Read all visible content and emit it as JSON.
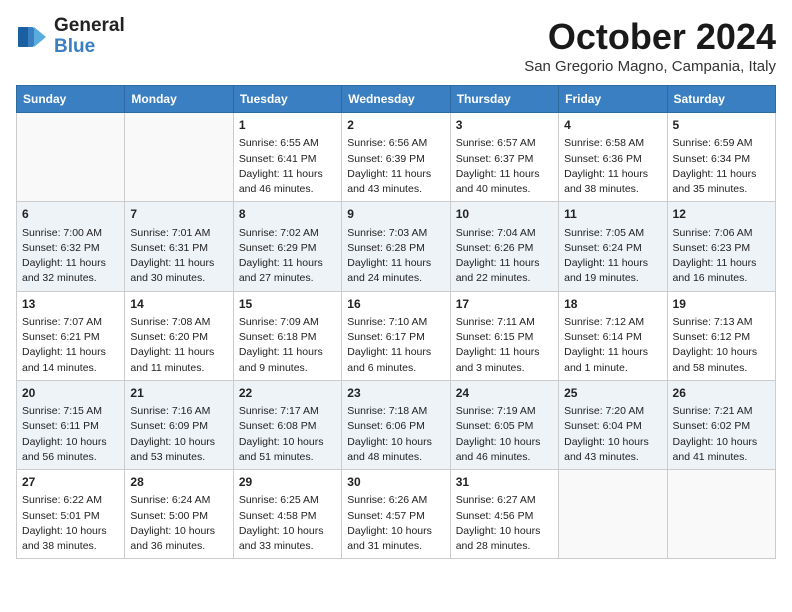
{
  "header": {
    "logo_line1": "General",
    "logo_line2": "Blue",
    "month": "October 2024",
    "location": "San Gregorio Magno, Campania, Italy"
  },
  "weekdays": [
    "Sunday",
    "Monday",
    "Tuesday",
    "Wednesday",
    "Thursday",
    "Friday",
    "Saturday"
  ],
  "weeks": [
    [
      {
        "day": null
      },
      {
        "day": null
      },
      {
        "day": "1",
        "sunrise": "Sunrise: 6:55 AM",
        "sunset": "Sunset: 6:41 PM",
        "daylight": "Daylight: 11 hours and 46 minutes."
      },
      {
        "day": "2",
        "sunrise": "Sunrise: 6:56 AM",
        "sunset": "Sunset: 6:39 PM",
        "daylight": "Daylight: 11 hours and 43 minutes."
      },
      {
        "day": "3",
        "sunrise": "Sunrise: 6:57 AM",
        "sunset": "Sunset: 6:37 PM",
        "daylight": "Daylight: 11 hours and 40 minutes."
      },
      {
        "day": "4",
        "sunrise": "Sunrise: 6:58 AM",
        "sunset": "Sunset: 6:36 PM",
        "daylight": "Daylight: 11 hours and 38 minutes."
      },
      {
        "day": "5",
        "sunrise": "Sunrise: 6:59 AM",
        "sunset": "Sunset: 6:34 PM",
        "daylight": "Daylight: 11 hours and 35 minutes."
      }
    ],
    [
      {
        "day": "6",
        "sunrise": "Sunrise: 7:00 AM",
        "sunset": "Sunset: 6:32 PM",
        "daylight": "Daylight: 11 hours and 32 minutes."
      },
      {
        "day": "7",
        "sunrise": "Sunrise: 7:01 AM",
        "sunset": "Sunset: 6:31 PM",
        "daylight": "Daylight: 11 hours and 30 minutes."
      },
      {
        "day": "8",
        "sunrise": "Sunrise: 7:02 AM",
        "sunset": "Sunset: 6:29 PM",
        "daylight": "Daylight: 11 hours and 27 minutes."
      },
      {
        "day": "9",
        "sunrise": "Sunrise: 7:03 AM",
        "sunset": "Sunset: 6:28 PM",
        "daylight": "Daylight: 11 hours and 24 minutes."
      },
      {
        "day": "10",
        "sunrise": "Sunrise: 7:04 AM",
        "sunset": "Sunset: 6:26 PM",
        "daylight": "Daylight: 11 hours and 22 minutes."
      },
      {
        "day": "11",
        "sunrise": "Sunrise: 7:05 AM",
        "sunset": "Sunset: 6:24 PM",
        "daylight": "Daylight: 11 hours and 19 minutes."
      },
      {
        "day": "12",
        "sunrise": "Sunrise: 7:06 AM",
        "sunset": "Sunset: 6:23 PM",
        "daylight": "Daylight: 11 hours and 16 minutes."
      }
    ],
    [
      {
        "day": "13",
        "sunrise": "Sunrise: 7:07 AM",
        "sunset": "Sunset: 6:21 PM",
        "daylight": "Daylight: 11 hours and 14 minutes."
      },
      {
        "day": "14",
        "sunrise": "Sunrise: 7:08 AM",
        "sunset": "Sunset: 6:20 PM",
        "daylight": "Daylight: 11 hours and 11 minutes."
      },
      {
        "day": "15",
        "sunrise": "Sunrise: 7:09 AM",
        "sunset": "Sunset: 6:18 PM",
        "daylight": "Daylight: 11 hours and 9 minutes."
      },
      {
        "day": "16",
        "sunrise": "Sunrise: 7:10 AM",
        "sunset": "Sunset: 6:17 PM",
        "daylight": "Daylight: 11 hours and 6 minutes."
      },
      {
        "day": "17",
        "sunrise": "Sunrise: 7:11 AM",
        "sunset": "Sunset: 6:15 PM",
        "daylight": "Daylight: 11 hours and 3 minutes."
      },
      {
        "day": "18",
        "sunrise": "Sunrise: 7:12 AM",
        "sunset": "Sunset: 6:14 PM",
        "daylight": "Daylight: 11 hours and 1 minute."
      },
      {
        "day": "19",
        "sunrise": "Sunrise: 7:13 AM",
        "sunset": "Sunset: 6:12 PM",
        "daylight": "Daylight: 10 hours and 58 minutes."
      }
    ],
    [
      {
        "day": "20",
        "sunrise": "Sunrise: 7:15 AM",
        "sunset": "Sunset: 6:11 PM",
        "daylight": "Daylight: 10 hours and 56 minutes."
      },
      {
        "day": "21",
        "sunrise": "Sunrise: 7:16 AM",
        "sunset": "Sunset: 6:09 PM",
        "daylight": "Daylight: 10 hours and 53 minutes."
      },
      {
        "day": "22",
        "sunrise": "Sunrise: 7:17 AM",
        "sunset": "Sunset: 6:08 PM",
        "daylight": "Daylight: 10 hours and 51 minutes."
      },
      {
        "day": "23",
        "sunrise": "Sunrise: 7:18 AM",
        "sunset": "Sunset: 6:06 PM",
        "daylight": "Daylight: 10 hours and 48 minutes."
      },
      {
        "day": "24",
        "sunrise": "Sunrise: 7:19 AM",
        "sunset": "Sunset: 6:05 PM",
        "daylight": "Daylight: 10 hours and 46 minutes."
      },
      {
        "day": "25",
        "sunrise": "Sunrise: 7:20 AM",
        "sunset": "Sunset: 6:04 PM",
        "daylight": "Daylight: 10 hours and 43 minutes."
      },
      {
        "day": "26",
        "sunrise": "Sunrise: 7:21 AM",
        "sunset": "Sunset: 6:02 PM",
        "daylight": "Daylight: 10 hours and 41 minutes."
      }
    ],
    [
      {
        "day": "27",
        "sunrise": "Sunrise: 6:22 AM",
        "sunset": "Sunset: 5:01 PM",
        "daylight": "Daylight: 10 hours and 38 minutes."
      },
      {
        "day": "28",
        "sunrise": "Sunrise: 6:24 AM",
        "sunset": "Sunset: 5:00 PM",
        "daylight": "Daylight: 10 hours and 36 minutes."
      },
      {
        "day": "29",
        "sunrise": "Sunrise: 6:25 AM",
        "sunset": "Sunset: 4:58 PM",
        "daylight": "Daylight: 10 hours and 33 minutes."
      },
      {
        "day": "30",
        "sunrise": "Sunrise: 6:26 AM",
        "sunset": "Sunset: 4:57 PM",
        "daylight": "Daylight: 10 hours and 31 minutes."
      },
      {
        "day": "31",
        "sunrise": "Sunrise: 6:27 AM",
        "sunset": "Sunset: 4:56 PM",
        "daylight": "Daylight: 10 hours and 28 minutes."
      },
      {
        "day": null
      },
      {
        "day": null
      }
    ]
  ]
}
